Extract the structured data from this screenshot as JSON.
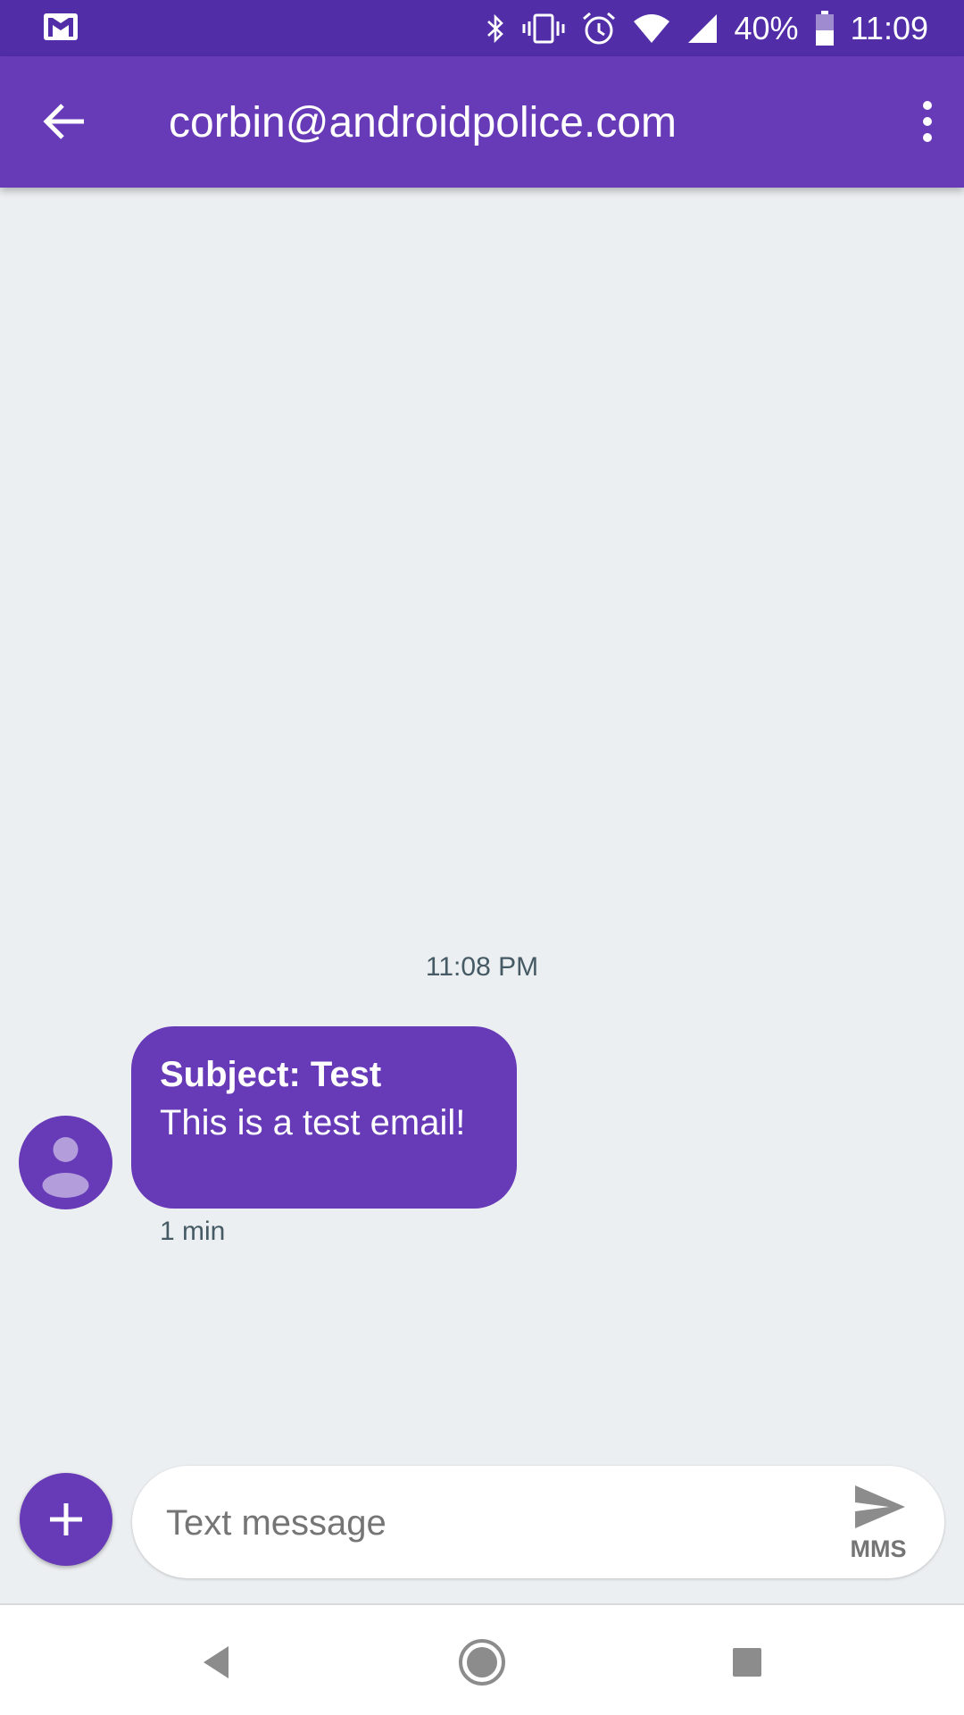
{
  "status_bar": {
    "battery_percent": "40%",
    "time": "11:09",
    "icons": [
      "gmail-icon",
      "bluetooth-icon",
      "vibrate-icon",
      "alarm-icon",
      "wifi-icon",
      "cell-signal-icon",
      "battery-icon"
    ]
  },
  "app_bar": {
    "title": "corbin@androidpolice.com",
    "icons": [
      "back-arrow-icon",
      "more-vert-icon"
    ]
  },
  "conversation": {
    "timestamp": "11:08 PM",
    "message": {
      "subject": "Subject: Test",
      "body": "This is a test email!",
      "time": "1 min"
    }
  },
  "compose": {
    "placeholder": "Text message",
    "send_label": "MMS",
    "icons": [
      "add-icon",
      "send-icon"
    ]
  },
  "nav_bar": {
    "icons": [
      "nav-back-icon",
      "nav-home-icon",
      "nav-recents-icon"
    ]
  },
  "colors": {
    "status_bar": "#512DA8",
    "app_bar": "#673AB7",
    "accent": "#673AB7",
    "background": "#ECEFF1"
  }
}
